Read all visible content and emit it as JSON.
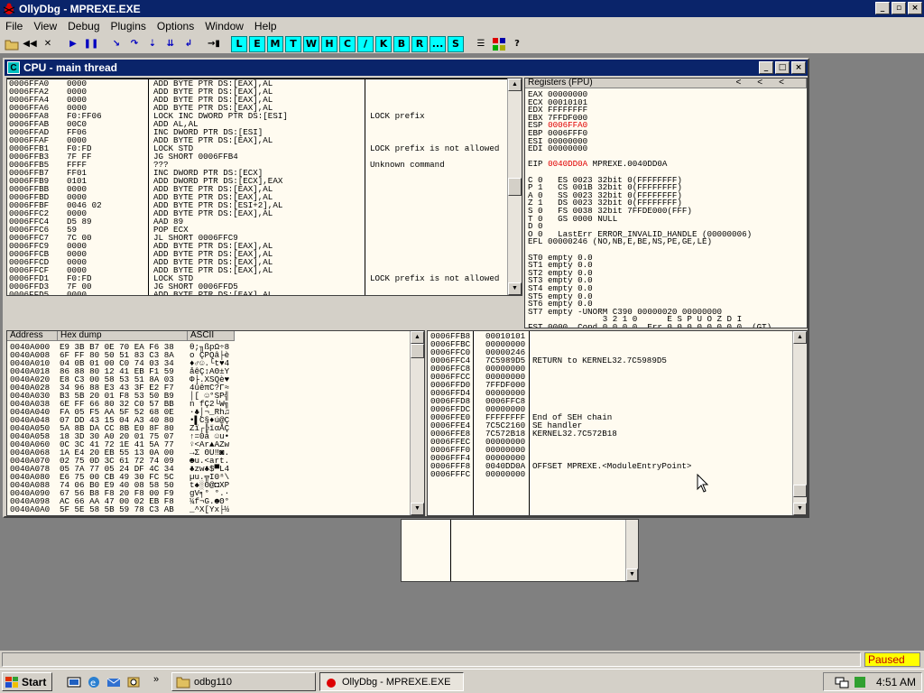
{
  "app": {
    "title": "OllyDbg - MPREXE.EXE"
  },
  "menu": [
    "File",
    "View",
    "Debug",
    "Plugins",
    "Options",
    "Window",
    "Help"
  ],
  "toolbar": {
    "letters": [
      "L",
      "E",
      "M",
      "T",
      "W",
      "H",
      "C",
      "/",
      "K",
      "B",
      "R",
      "...",
      "S"
    ]
  },
  "cpu": {
    "title": "CPU - main thread",
    "disasm": [
      [
        "0006FFA0",
        "0000",
        "ADD BYTE PTR DS:[EAX],AL",
        ""
      ],
      [
        "0006FFA2",
        "0000",
        "ADD BYTE PTR DS:[EAX],AL",
        ""
      ],
      [
        "0006FFA4",
        "0000",
        "ADD BYTE PTR DS:[EAX],AL",
        ""
      ],
      [
        "0006FFA6",
        "0000",
        "ADD BYTE PTR DS:[EAX],AL",
        ""
      ],
      [
        "0006FFA8",
        "F0:FF06",
        "LOCK INC DWORD PTR DS:[ESI]",
        "LOCK prefix"
      ],
      [
        "0006FFAB",
        "00C0",
        "ADD AL,AL",
        ""
      ],
      [
        "0006FFAD",
        "FF06",
        "INC DWORD PTR DS:[ESI]",
        ""
      ],
      [
        "0006FFAF",
        "0000",
        "ADD BYTE PTR DS:[EAX],AL",
        ""
      ],
      [
        "0006FFB1",
        "F0:FD",
        "LOCK STD",
        "LOCK prefix is not allowed"
      ],
      [
        "0006FFB3",
        "7F FF",
        "JG SHORT 0006FFB4",
        ""
      ],
      [
        "0006FFB5",
        "FFFF",
        "???",
        "Unknown command"
      ],
      [
        "0006FFB7",
        "FF01",
        "INC DWORD PTR DS:[ECX]",
        ""
      ],
      [
        "0006FFB9",
        "0101",
        "ADD DWORD PTR DS:[ECX],EAX",
        ""
      ],
      [
        "0006FFBB",
        "0000",
        "ADD BYTE PTR DS:[EAX],AL",
        ""
      ],
      [
        "0006FFBD",
        "0000",
        "ADD BYTE PTR DS:[EAX],AL",
        ""
      ],
      [
        "0006FFBF",
        "0046 02",
        "ADD BYTE PTR DS:[ESI+2],AL",
        ""
      ],
      [
        "0006FFC2",
        "0000",
        "ADD BYTE PTR DS:[EAX],AL",
        ""
      ],
      [
        "0006FFC4",
        "D5 89",
        "AAD 89",
        ""
      ],
      [
        "0006FFC6",
        "59",
        "POP ECX",
        ""
      ],
      [
        "0006FFC7",
        "7C 00",
        "JL SHORT 0006FFC9",
        ""
      ],
      [
        "0006FFC9",
        "0000",
        "ADD BYTE PTR DS:[EAX],AL",
        ""
      ],
      [
        "0006FFCB",
        "0000",
        "ADD BYTE PTR DS:[EAX],AL",
        ""
      ],
      [
        "0006FFCD",
        "0000",
        "ADD BYTE PTR DS:[EAX],AL",
        ""
      ],
      [
        "0006FFCF",
        "0000",
        "ADD BYTE PTR DS:[EAX],AL",
        ""
      ],
      [
        "0006FFD1",
        "F0:FD",
        "LOCK STD",
        "LOCK prefix is not allowed"
      ],
      [
        "0006FFD3",
        "7F 00",
        "JG SHORT 0006FFD5",
        ""
      ],
      [
        "0006FFD5",
        "0000",
        "ADD BYTE PTR DS:[EAX],AL",
        ""
      ]
    ],
    "registers_title": "Registers (FPU)",
    "registers": [
      "EAX 00000000",
      "ECX 00010101",
      "EDX FFFFFFFF",
      "EBX 7FFDF000",
      "ESP 0006FFA0",
      "EBP 0006FFF0",
      "ESI 00000000",
      "EDI 00000000",
      "",
      "EIP 0040DD0A MPREXE.0040DD0A",
      "",
      "C 0   ES 0023 32bit 0(FFFFFFFF)",
      "P 1   CS 001B 32bit 0(FFFFFFFF)",
      "A 0   SS 0023 32bit 0(FFFFFFFF)",
      "Z 1   DS 0023 32bit 0(FFFFFFFF)",
      "S 0   FS 0038 32bit 7FFDE000(FFF)",
      "T 0   GS 0000 NULL",
      "D 0",
      "O 0   LastErr ERROR_INVALID_HANDLE (00000006)",
      "EFL 00000246 (NO,NB,E,BE,NS,PE,GE,LE)",
      "",
      "ST0 empty 0.0",
      "ST1 empty 0.0",
      "ST2 empty 0.0",
      "ST3 empty 0.0",
      "ST4 empty 0.0",
      "ST5 empty 0.0",
      "ST6 empty 0.0",
      "ST7 empty -UNORM C390 00000020 00000000",
      "               3 2 1 0      E S P U O Z D I",
      "FST 0000  Cond 0 0 0 0  Err 0 0 0 0 0 0 0 0  (GT)"
    ],
    "dump_headers": [
      "Address",
      "Hex dump",
      "ASCII"
    ],
    "dump": [
      [
        "0040A000",
        "E9 3B B7 0E 70 EA F6 38",
        "θ;╖ßpΩ÷8"
      ],
      [
        "0040A008",
        "6F FF 80 50 51 83 C3 8A",
        "o ÇPQâ├è"
      ],
      [
        "0040A010",
        "04 0B 01 00 C0 74 03 34",
        "♦♂☺.└t♥4"
      ],
      [
        "0040A018",
        "86 88 80 12 41 EB F1 59",
        "åêÇ↕AΘ±Y"
      ],
      [
        "0040A020",
        "E8 C3 00 58 53 51 8A 03",
        "Φ├.XSQè♥"
      ],
      [
        "0040A028",
        "34 96 88 E3 43 3F E2 F7",
        "4ûêπC?Γ≈"
      ],
      [
        "0040A030",
        "B3 5B 20 01 F8 53 50 B9",
        "│[ ☺°SP╣"
      ],
      [
        "0040A038",
        "6E FF 66 80 32 C0 57 BB",
        "n fÇ2└W╗"
      ],
      [
        "0040A040",
        "FA 05 F5 AA 5F 52 68 0E",
        "·♣⌡¬_Rh♫"
      ],
      [
        "0040A048",
        "07 DD 43 15 04 A3 40 80",
        "•▌C§♦ú@Ç"
      ],
      [
        "0040A050",
        "5A 8B DA CC 8B E0 8F 80",
        "Zï┌╠ïαÅÇ"
      ],
      [
        "0040A058",
        "18 3D 30 A0 20 01 75 07",
        "↑=0á ☺u•"
      ],
      [
        "0040A060",
        "0C 3C 41 72 1E 41 5A 77",
        "♀<Ar▲AZw"
      ],
      [
        "0040A068",
        "1A E4 20 EB 55 13 0A 00",
        "→Σ ΘU‼◙."
      ],
      [
        "0040A070",
        "02 75 0D 3C 61 72 74 09",
        "☻u.<art."
      ],
      [
        "0040A078",
        "05 7A 77 05 24 DF 4C 34",
        "♣zw♣$▀L4"
      ],
      [
        "0040A080",
        "E6 75 00 CB 49 30 FC 5C",
        "µu.╦I0ⁿ\\"
      ],
      [
        "0040A088",
        "74 06 B0 E9 40 08 58 50",
        "t♠░Θ@◘XP"
      ],
      [
        "0040A090",
        "67 56 B8 F8 20 F8 00 F9",
        "gV╕° °.∙"
      ],
      [
        "0040A098",
        "AC 66 AA 47 00 02 EB F8",
        "¼f¬G.☻Θ°"
      ],
      [
        "0040A0A0",
        "5F 5E 58 5B 59 78 C3 AB",
        "_^X[Yx├½"
      ]
    ],
    "stack": [
      [
        "0006FFB8",
        "00010101",
        ""
      ],
      [
        "0006FFBC",
        "00000000",
        ""
      ],
      [
        "0006FFC0",
        "00000246",
        ""
      ],
      [
        "0006FFC4",
        "7C5989D5",
        "RETURN to KERNEL32.7C5989D5"
      ],
      [
        "0006FFC8",
        "00000000",
        ""
      ],
      [
        "0006FFCC",
        "00000000",
        ""
      ],
      [
        "0006FFD0",
        "7FFDF000",
        ""
      ],
      [
        "0006FFD4",
        "00000000",
        ""
      ],
      [
        "0006FFD8",
        "0006FFC8",
        ""
      ],
      [
        "0006FFDC",
        "00000000",
        ""
      ],
      [
        "0006FFE0",
        "FFFFFFFF",
        "End of SEH chain"
      ],
      [
        "0006FFE4",
        "7C5C2160",
        "SE handler"
      ],
      [
        "0006FFE8",
        "7C572B18",
        "KERNEL32.7C572B18"
      ],
      [
        "0006FFEC",
        "00000000",
        ""
      ],
      [
        "0006FFF0",
        "00000000",
        ""
      ],
      [
        "0006FFF4",
        "00000000",
        ""
      ],
      [
        "0006FFF8",
        "0040DD0A",
        "OFFSET MPREXE.<ModuleEntryPoint>"
      ],
      [
        "0006FFFC",
        "00000000",
        ""
      ]
    ]
  },
  "status": {
    "state": "Paused"
  },
  "taskbar": {
    "start_label": "Start",
    "tasks": [
      "odbg110",
      "OllyDbg - MPREXE.EXE"
    ],
    "clock": "4:51 AM"
  },
  "colors": {
    "title_active": "#0a246a",
    "highlight_red": "#e00000",
    "letter_btn": "#00ffff",
    "pane_bg": "#fffbf0",
    "paused_bg": "#ffff00"
  }
}
